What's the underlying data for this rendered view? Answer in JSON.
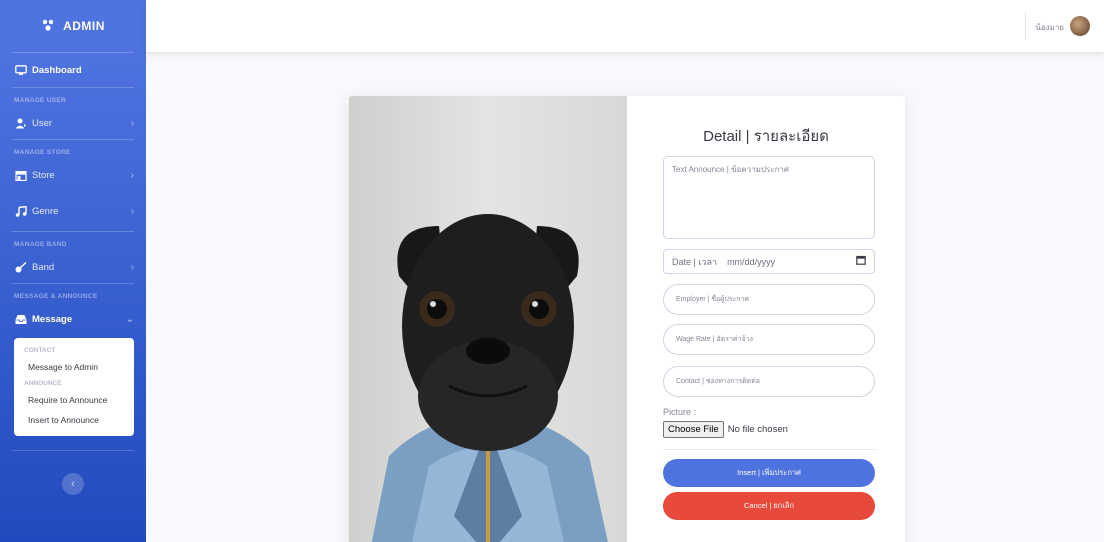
{
  "sidebar": {
    "brand": "ADMIN",
    "brand_icon": "admin-logo-icon",
    "dashboard": "Dashboard",
    "heading_user": "MANAGE USER",
    "user": "User",
    "heading_store": "MANAGE STORE",
    "store": "Store",
    "genre": "Genre",
    "heading_band": "MANAGE BAND",
    "band": "Band",
    "heading_message": "MESSAGE & ANNOUNCE",
    "message": "Message",
    "submenu": {
      "contact_heading": "CONTACT",
      "message_to_admin": "Message to Admin",
      "announce_heading": "ANNOUNCE",
      "require_to_announce": "Require to Announce",
      "insert_to_announce": "Insert to Announce"
    },
    "toggle_icon": "chevron-left-icon"
  },
  "topbar": {
    "username": "น้องมาย"
  },
  "form": {
    "title": "Detail | รายละเอียด",
    "text_placeholder": "Text Announce | ข้อความประกาศ",
    "date_label": "Date | เวลา",
    "date_value": "mm/dd/yyyy",
    "employer_placeholder": "Employer | ชื่อผู้ประกาศ",
    "wage_placeholder": "Wage Rate | อัตราค่าจ้าง",
    "contact_placeholder": "Contact | ช่องทางการติดต่อ",
    "picture_label": "Picture :",
    "choose_file": "Choose File",
    "no_file": "No file chosen",
    "insert_button": "Insert | เพิ่มประกาศ",
    "cancel_button": "Cancel | ยกเลิก"
  },
  "colors": {
    "primary": "#4e73df",
    "danger": "#e74a3b",
    "sidebar_dark": "#224abe"
  }
}
